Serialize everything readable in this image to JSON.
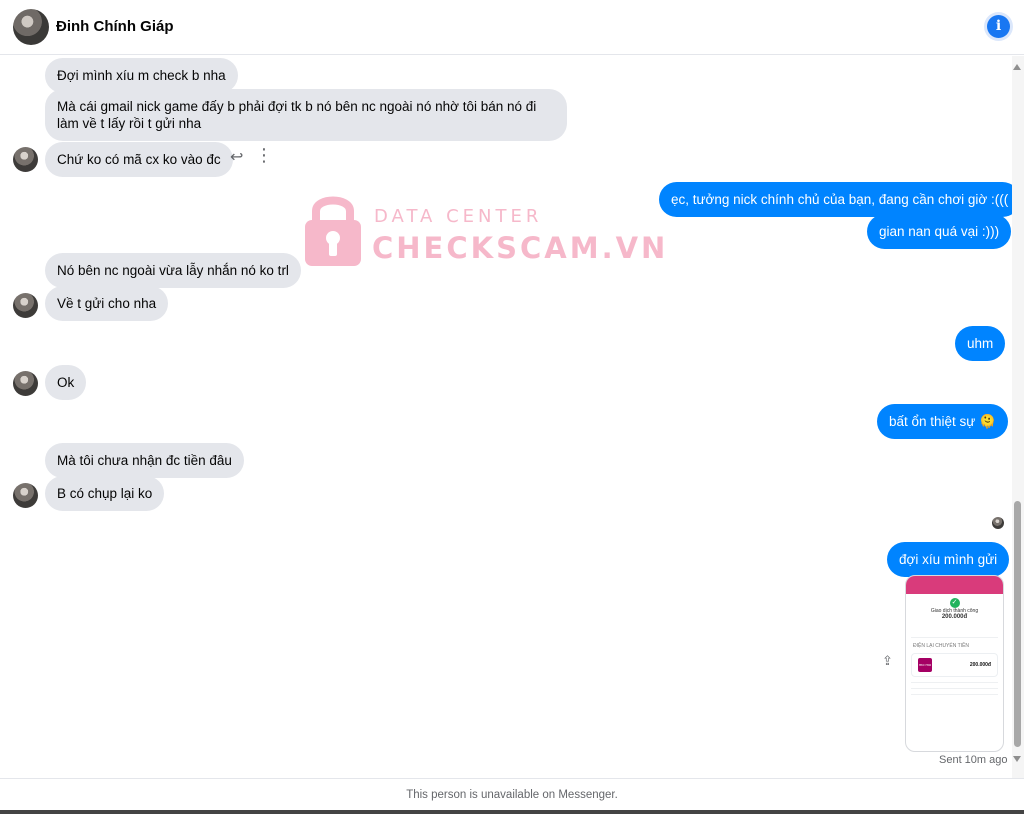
{
  "header": {
    "contact_name": "Đinh Chính Giáp",
    "info_icon": "info-icon"
  },
  "messages": [
    {
      "text": "Đợi mình xíu m check b nha",
      "sender": "contact"
    },
    {
      "text": "Mà cái gmail nick game đấy b phải đợi tk b nó bên nc ngoài nó nhờ tôi bán nó đi làm về t lấy rồi t gửi nha",
      "sender": "contact"
    },
    {
      "text": "Chứ ko có mã cx ko vào đc",
      "sender": "contact"
    },
    {
      "text": "ẹc, tưởng nick chính chủ của bạn, đang cần chơi giờ :(((",
      "sender": "me"
    },
    {
      "text": "gian nan quá vại :)))",
      "sender": "me"
    },
    {
      "text": "Nó bên nc ngoài vừa lẫy nhắn nó ko trl",
      "sender": "contact"
    },
    {
      "text": "Về t gửi cho nha",
      "sender": "contact"
    },
    {
      "text": "uhm",
      "sender": "me"
    },
    {
      "text": "Ok",
      "sender": "contact"
    },
    {
      "text": "bất ổn thiệt sự 🫠",
      "sender": "me"
    },
    {
      "text": "Mà tôi chưa nhận đc tiền đâu",
      "sender": "contact"
    },
    {
      "text": "B có chụp lại ko",
      "sender": "contact"
    },
    {
      "text": "đợi xíu mình gửi",
      "sender": "me"
    }
  ],
  "watermark": {
    "line1": "DATA CENTER",
    "line2": "CHECKSCAM.VN"
  },
  "receipt": {
    "success_label": "Giao dịch thành công",
    "amount": "200.000đ",
    "section_label": "ĐIỆN LẠI CHUYỂN TIỀN",
    "logo_text": "mo mo",
    "box_amount": "200.000đ"
  },
  "status": {
    "sent": "Sent 10m ago"
  },
  "footer": {
    "text": "This person is unavailable on Messenger."
  }
}
